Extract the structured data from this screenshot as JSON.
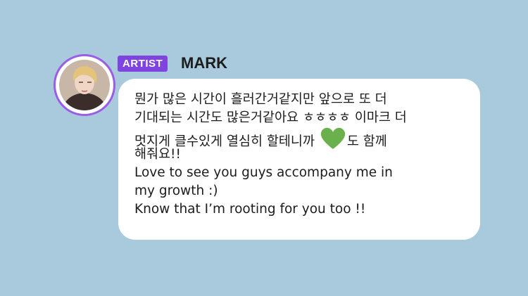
{
  "author": {
    "badge": "ARTIST",
    "name": "MARK"
  },
  "message": {
    "lines": [
      "뭔가 많은 시간이 흘러간거같지만 앞으로 또 더",
      "기대되는 시간도 많은거같아요 ㅎㅎㅎㅎ 이마크 더",
      "멋지게 클수있게 열심히 할테니까",
      "도 함께",
      "해줘요!!",
      "Love to see you guys accompany me in",
      "my growth :)",
      "Know that I’m rooting for you too !!"
    ],
    "emoji": "green-heart-icon"
  },
  "colors": {
    "background": "#a9c9dd",
    "badge": "#7f44e0",
    "avatar_ring": "#9b5de5",
    "heart": "#6ab04c"
  }
}
